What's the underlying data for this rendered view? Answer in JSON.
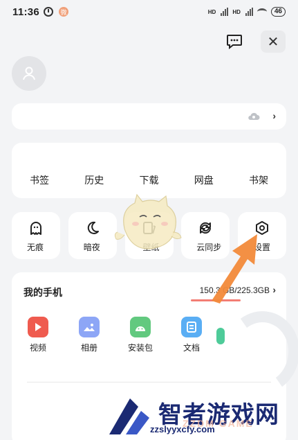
{
  "status": {
    "time": "11:36",
    "badge": "微",
    "battery": "46"
  },
  "quick_links": [
    "书签",
    "历史",
    "下载",
    "网盘",
    "书架"
  ],
  "tiles": [
    {
      "label": "无痕",
      "icon": "ghost-icon"
    },
    {
      "label": "暗夜",
      "icon": "moon-icon"
    },
    {
      "label": "壁纸",
      "icon": "wallpaper-icon"
    },
    {
      "label": "云同步",
      "icon": "sync-icon"
    },
    {
      "label": "设置",
      "icon": "settings-icon"
    }
  ],
  "phone": {
    "title": "我的手机",
    "storage": "150.3 GB/225.3GB",
    "storage_used_fraction": 0.67,
    "apps": [
      {
        "label": "视频",
        "icon": "video-icon",
        "color": "#ef5b4f"
      },
      {
        "label": "相册",
        "icon": "album-icon",
        "color": "#8da6f6"
      },
      {
        "label": "安装包",
        "icon": "android-icon",
        "color": "#62c97f"
      },
      {
        "label": "文档",
        "icon": "document-icon",
        "color": "#5aaef4"
      }
    ]
  },
  "watermark": {
    "title": "智者游戏网",
    "url": "zzslyyxcfy.com",
    "faint": "ZZDM GAME"
  },
  "colors": {
    "accent_arrow": "#f28a3a",
    "watermark": "#1b2a73"
  }
}
